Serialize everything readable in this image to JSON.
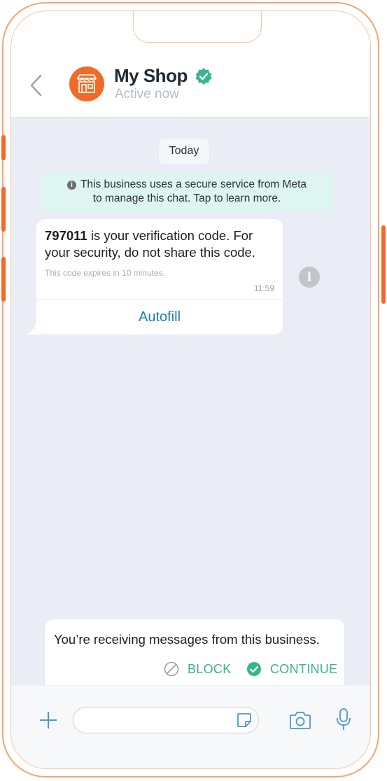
{
  "header": {
    "shop_name": "My Shop",
    "status": "Active now",
    "verified": true
  },
  "chat": {
    "date_label": "Today",
    "notice_line1": "This business uses a secure service from Meta",
    "notice_line2": "to manage this chat. Tap to learn more.",
    "message": {
      "code": "797011",
      "text": " is your verification code. For your security, do not share this code.",
      "expiry": "This code expires in 10 minutes.",
      "time": "11:59",
      "autofill_label": "Autofill"
    }
  },
  "banner": {
    "text": "You’re receiving messages from this business.",
    "block_label": "BLOCK",
    "continue_label": "CONTINUE"
  },
  "colors": {
    "brand": "#f26a2a",
    "verified": "#37b58e",
    "link": "#1d7fae",
    "chat_bg": "#eaecf6",
    "notice_bg": "#dff5ef"
  },
  "icons": [
    "back-chevron-icon",
    "store-icon",
    "verified-badge-icon",
    "info-icon",
    "block-icon",
    "check-circle-icon",
    "plus-icon",
    "sticker-icon",
    "camera-icon",
    "microphone-icon"
  ]
}
